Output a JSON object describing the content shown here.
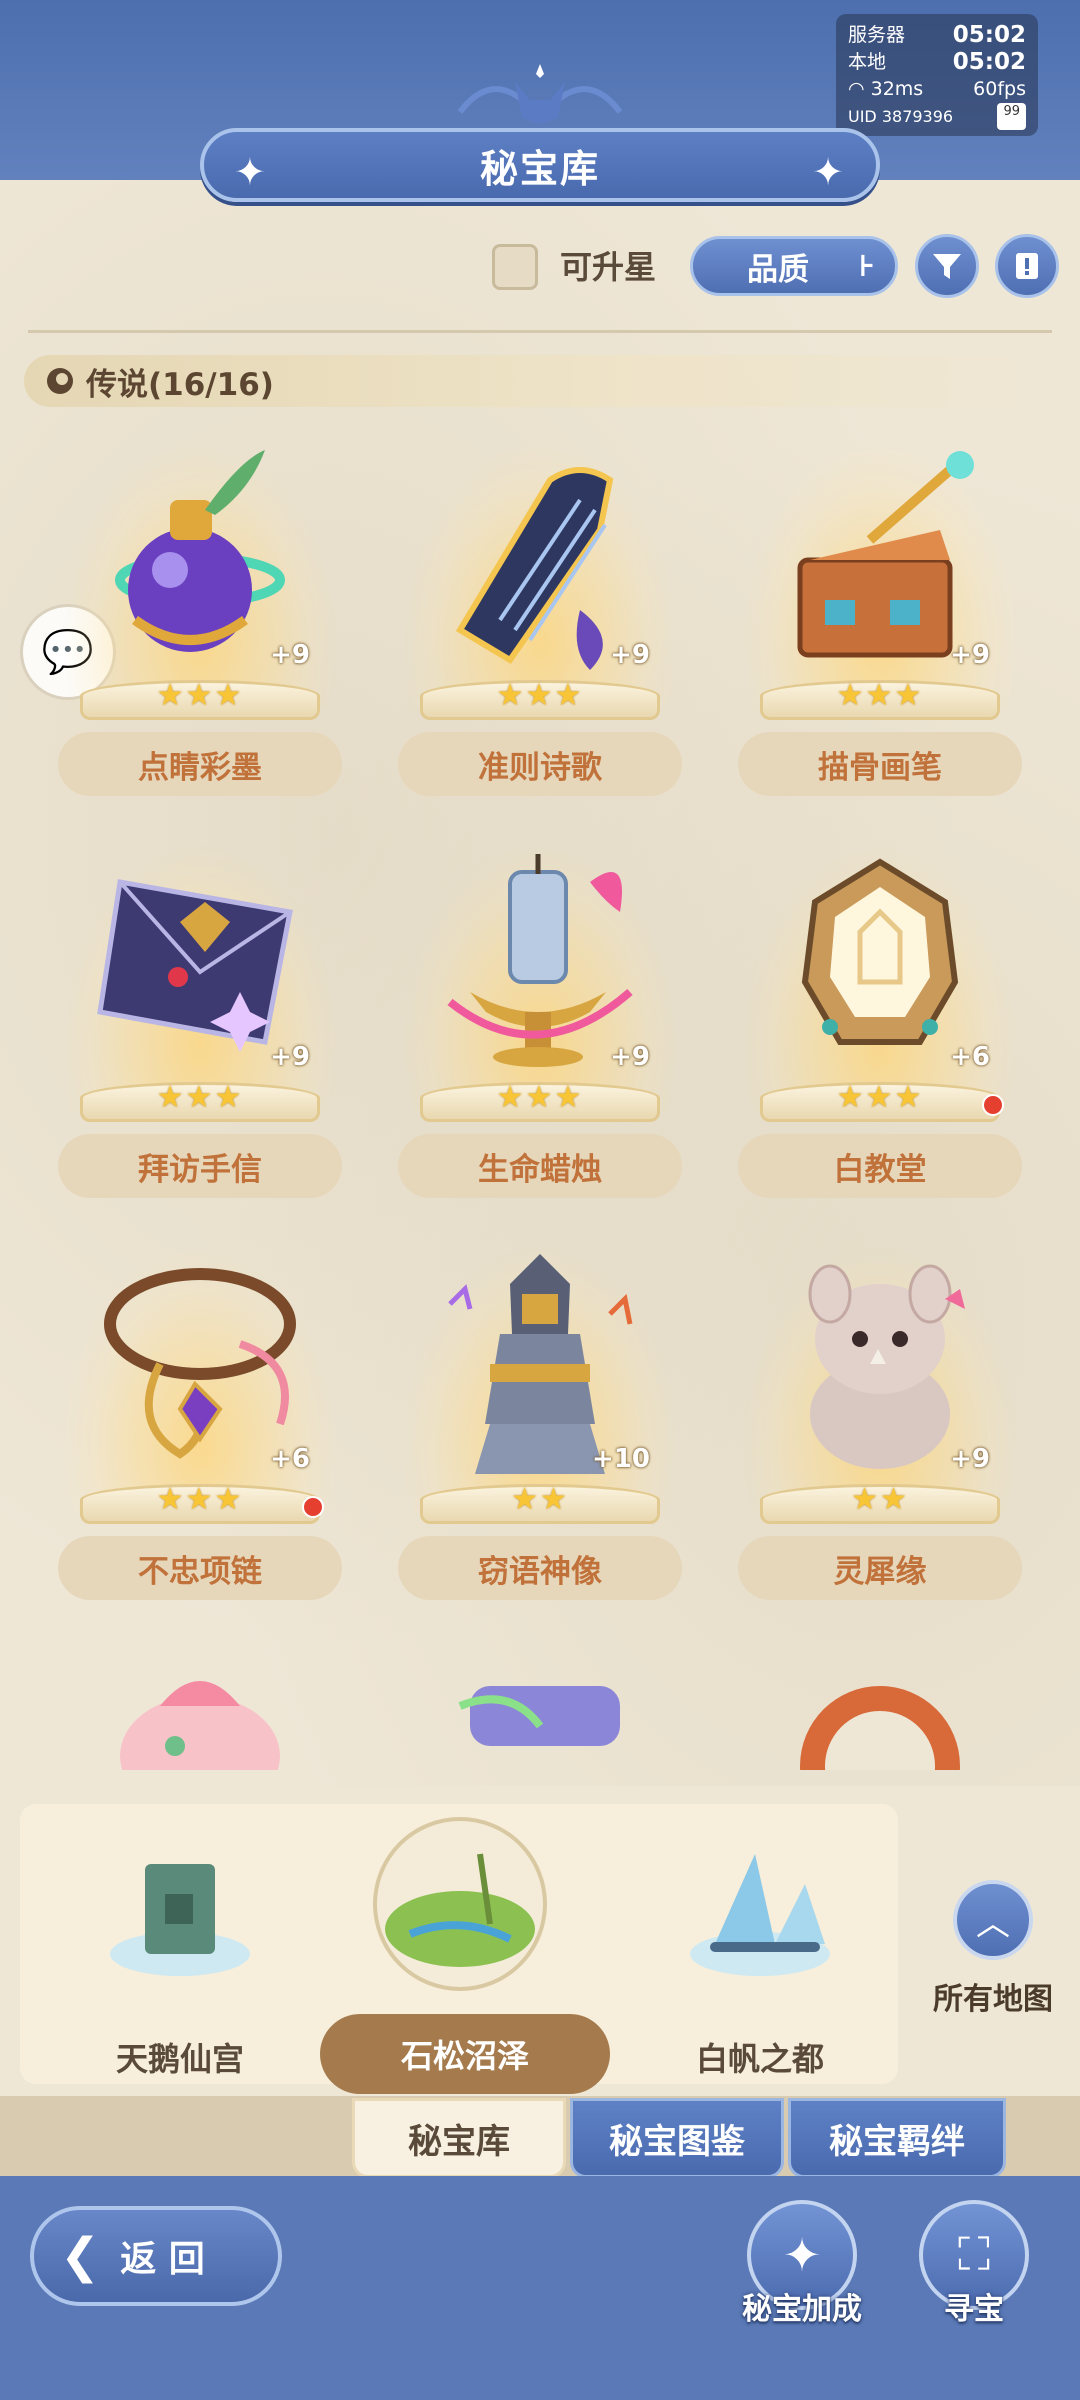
{
  "status": {
    "server_label": "服务器",
    "server_time": "05:02",
    "local_label": "本地",
    "local_time": "05:02",
    "ping": "32ms",
    "fps": "60fps",
    "uid": "UID 3879396",
    "battery": "99"
  },
  "header": {
    "title": "秘宝库"
  },
  "filters": {
    "can_upgrade_label": "可升星",
    "can_upgrade_checked": false,
    "sort_label": "品质"
  },
  "section": {
    "label": "传说(16/16)"
  },
  "items": [
    {
      "name": "点睛彩墨",
      "level": "+9",
      "stars": "★★★",
      "art": "ink-potion-icon",
      "red_dot": false
    },
    {
      "name": "准则诗歌",
      "level": "+9",
      "stars": "★★★",
      "art": "lyre-icon",
      "red_dot": false
    },
    {
      "name": "描骨画笔",
      "level": "+9",
      "stars": "★★★",
      "art": "paint-chest-icon",
      "red_dot": false
    },
    {
      "name": "拜访手信",
      "level": "+9",
      "stars": "★★★",
      "art": "envelope-icon",
      "red_dot": false
    },
    {
      "name": "生命蜡烛",
      "level": "+9",
      "stars": "★★★",
      "art": "candle-icon",
      "red_dot": false
    },
    {
      "name": "白教堂",
      "level": "+6",
      "stars": "★★★",
      "art": "chapel-icon",
      "red_dot": true
    },
    {
      "name": "不忠项链",
      "level": "+6",
      "stars": "★★★",
      "art": "necklace-icon",
      "red_dot": true
    },
    {
      "name": "窃语神像",
      "level": "+10",
      "stars": "★★",
      "art": "statue-icon",
      "red_dot": false
    },
    {
      "name": "灵犀缘",
      "level": "+9",
      "stars": "★★",
      "art": "rhino-plush-icon",
      "red_dot": false
    }
  ],
  "maps": [
    {
      "name": "天鹅仙宫",
      "active": false
    },
    {
      "name": "石松沼泽",
      "active": true
    },
    {
      "name": "白帆之都",
      "active": false
    }
  ],
  "all_maps_label": "所有地图",
  "tabs": [
    {
      "label": "秘宝库",
      "active": true
    },
    {
      "label": "秘宝图鉴",
      "active": false
    },
    {
      "label": "秘宝羁绊",
      "active": false
    }
  ],
  "bottom": {
    "back_label": "返 回",
    "boost_label": "秘宝加成",
    "treasure_label": "寻宝"
  },
  "colors": {
    "accent_blue": "#4f6fb3",
    "paper": "#efe7d6",
    "name_text": "#c1723a",
    "star": "#f8c537",
    "badge_red": "#e5402f"
  }
}
